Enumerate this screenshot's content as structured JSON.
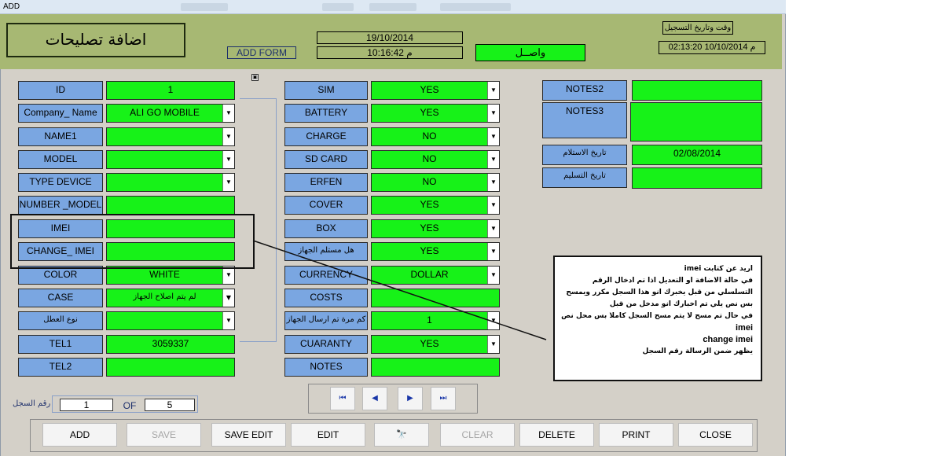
{
  "window": {
    "title": "ADD"
  },
  "header": {
    "form_title": "اضافة تصليحات",
    "add_form_label": "ADD FORM",
    "date": "19/10/2014",
    "time": "10:16:42 م",
    "status": "واصــل",
    "registration_label": "وقت وتاريخ التسجيل",
    "registration_datetime": "02:13:20 10/10/2014 م"
  },
  "col1": [
    {
      "label": "ID",
      "value": "1",
      "dropdown": false
    },
    {
      "label": "Company_ Name",
      "value": "ALI GO MOBILE",
      "dropdown": true
    },
    {
      "label": "NAME1",
      "value": "",
      "dropdown": true
    },
    {
      "label": "MODEL",
      "value": "",
      "dropdown": true
    },
    {
      "label": "TYPE DEVICE",
      "value": "",
      "dropdown": true
    },
    {
      "label": "NUMBER _MODEL",
      "value": "",
      "dropdown": false
    },
    {
      "label": "IMEI",
      "value": "",
      "dropdown": false
    },
    {
      "label": "CHANGE_ IMEI",
      "value": "",
      "dropdown": false
    },
    {
      "label": "COLOR",
      "value": "WHITE",
      "dropdown": true
    },
    {
      "label": "CASE",
      "value": "لم يتم اصلاح الجهاز",
      "dropdown": true
    },
    {
      "label": "نوع العطل",
      "value": "",
      "dropdown": true
    },
    {
      "label": "TEL1",
      "value": "3059337",
      "dropdown": false
    },
    {
      "label": "TEL2",
      "value": "",
      "dropdown": false
    }
  ],
  "col2": [
    {
      "label": "SIM",
      "value": "YES",
      "dropdown": true
    },
    {
      "label": "BATTERY",
      "value": "YES",
      "dropdown": true
    },
    {
      "label": "CHARGE",
      "value": "NO",
      "dropdown": true
    },
    {
      "label": "SD CARD",
      "value": "NO",
      "dropdown": true
    },
    {
      "label": "ERFEN",
      "value": "NO",
      "dropdown": true
    },
    {
      "label": "COVER",
      "value": "YES",
      "dropdown": true
    },
    {
      "label": "BOX",
      "value": "YES",
      "dropdown": true
    },
    {
      "label": "هل مستلم الجهاز",
      "value": "YES",
      "dropdown": true
    },
    {
      "label": "CURRENCY",
      "value": "DOLLAR",
      "dropdown": true
    },
    {
      "label": "COSTS",
      "value": "",
      "dropdown": false
    },
    {
      "label": "كم مرة تم ارسال الجهاز",
      "value": "1",
      "dropdown": true
    },
    {
      "label": "CUARANTY",
      "value": "YES",
      "dropdown": true
    },
    {
      "label": "NOTES",
      "value": "",
      "dropdown": false
    }
  ],
  "col3": {
    "notes2": {
      "label": "NOTES2",
      "value": ""
    },
    "notes3": {
      "label": "NOTES3",
      "value": ""
    },
    "receive_date": {
      "label": "تاريخ الاستلام",
      "value": "02/08/2014"
    },
    "delivery_date": {
      "label": "تاريخ التسليم",
      "value": ""
    }
  },
  "note": {
    "lines": [
      "اريد عن كتابت imei",
      "في حالة الاضافة  او التعديل اذا تم ادخال الرقم",
      "التسلسلي من قبل يخبرك انو  هذا السجل مكرر ويمسح",
      "بس  نص يلي تم اخبارك انو مدخل من قبل",
      "في حال تم مسح لا يتم مسح السجل كاملا بس محل نص",
      "imei",
      "change imei",
      "يظهر ضمن الرسالة رقم السجل"
    ]
  },
  "navigation": {
    "first": "⏮",
    "prev": "◀",
    "next": "▶",
    "last": "⏭"
  },
  "record": {
    "label": "رقم السجل",
    "current": "1",
    "of": "OF",
    "total": "5"
  },
  "actions": {
    "add": "ADD",
    "save": "SAVE",
    "save_edit": "SAVE EDIT",
    "edit": "EDIT",
    "find": "🔭",
    "clear": "CLEAR",
    "delete": "DELETE",
    "print": "PRINT",
    "close": "CLOSE"
  },
  "colors": {
    "label_blue": "#7aa6e1",
    "field_green": "#17f218",
    "header_olive": "#a7b873",
    "window_gray": "#d4d0c8"
  },
  "icons": {
    "dropdown": "chevron-down-icon",
    "corner": "record-selector-icon"
  }
}
